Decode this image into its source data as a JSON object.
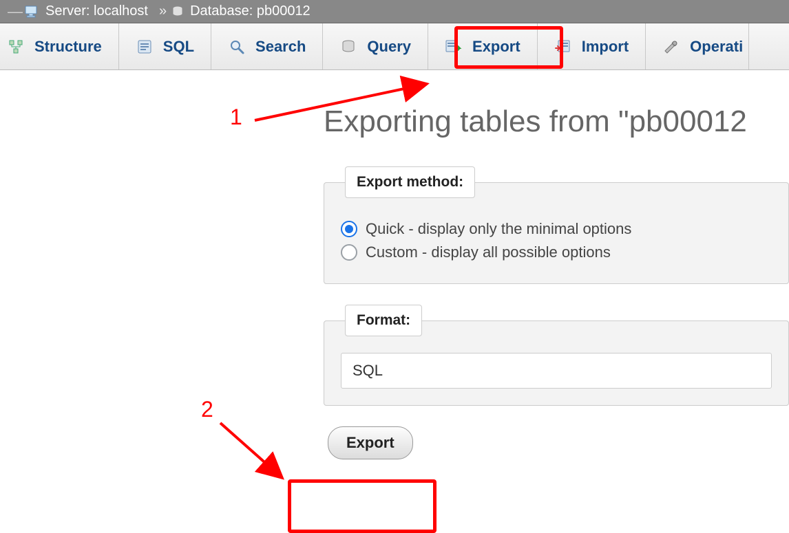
{
  "breadcrumb": {
    "server_label": "Server: localhost",
    "separator": "»",
    "database_label": "Database: pb00012"
  },
  "tabs": {
    "structure": "Structure",
    "sql": "SQL",
    "search": "Search",
    "query": "Query",
    "export": "Export",
    "import": "Import",
    "operations": "Operati"
  },
  "page": {
    "title": "Exporting tables from \"pb00012"
  },
  "export_method": {
    "legend": "Export method:",
    "quick_label": "Quick - display only the minimal options",
    "custom_label": "Custom - display all possible options",
    "selected": "quick"
  },
  "format": {
    "legend": "Format:",
    "selected": "SQL"
  },
  "buttons": {
    "export": "Export"
  },
  "annotations": {
    "one": "1",
    "two": "2"
  }
}
